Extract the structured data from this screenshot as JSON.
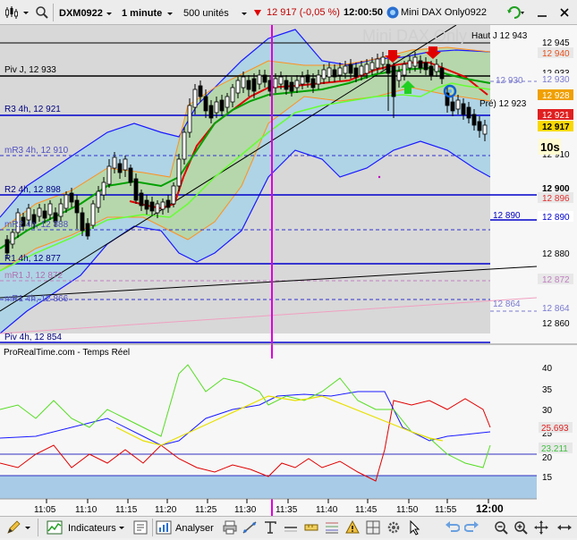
{
  "toolbar": {
    "instrument": "DXM0922",
    "timeframe": "1 minute",
    "units": "500 unités",
    "price_change": "12 917  (-0,05 %)",
    "clock": "12:00:50",
    "product": "Mini DAX Only0922"
  },
  "chart": {
    "watermark": "Mini DAX Only",
    "provider": "ProRealTime.com - Temps Réel",
    "countdown": "10s",
    "price_ticks": [
      "12 945",
      "12 933",
      "12 910",
      "12 900",
      "12 880",
      "12 860"
    ],
    "price_boxes": [
      {
        "text": "12 940",
        "color": "#e8501a",
        "bg": "#e8e8e8"
      },
      {
        "text": "12 930",
        "color": "#7a7ad0",
        "bg": "#f7f7f7"
      },
      {
        "text": "12 928",
        "color": "#ffffff",
        "bg": "#f0a000"
      },
      {
        "text": "12 921",
        "color": "#ffffff",
        "bg": "#e02020"
      },
      {
        "text": "12 917",
        "color": "#000000",
        "bg": "#f8d800"
      },
      {
        "text": "12 896",
        "color": "#e03030",
        "bg": "#e8e8e8"
      },
      {
        "text": "12 890",
        "color": "#0000d0",
        "bg": "#ffffff"
      },
      {
        "text": "12 872",
        "color": "#c080c0",
        "bg": "#e8e8e8"
      },
      {
        "text": "12 864",
        "color": "#7a7ad0",
        "bg": "#f7f7f7"
      }
    ],
    "levels": {
      "haut_j": "Haut J 12 943",
      "piv_j": "Piv J, 12 933",
      "r3_4h": "R3 4h, 12 921",
      "pre": "Pré) 12 923",
      "mr3_4h": "mR3 4h, 12 910",
      "r2_4h": "R2 4h, 12 898",
      "mr2_4h": "mR2 4h, 12 888",
      "r1_4h": "R1 4h, 12 877",
      "pr1_j": "mR1 J, 12 872",
      "mr1_4h": "mR1 4h, 12 866",
      "piv_4h": "Piv 4h, 12 854",
      "right_890": "12 890",
      "right_864": "12 864",
      "right_930": "12 930"
    },
    "osc_ticks": [
      "40",
      "35",
      "30",
      "25",
      "20",
      "15"
    ],
    "osc_boxes": [
      {
        "text": "25.693",
        "color": "#e02020"
      },
      {
        "text": "23.211",
        "color": "#60d060"
      }
    ],
    "time_ticks": [
      "11:05",
      "11:10",
      "11:15",
      "11:20",
      "11:25",
      "11:30",
      "11:35",
      "11:40",
      "11:45",
      "11:50",
      "11:55",
      "12:00"
    ]
  },
  "bottombar": {
    "indicators": "Indicateurs",
    "analyser": "Analyser"
  },
  "colors": {
    "bollinger": "#1a1aff",
    "red_ma": "#e00000",
    "green_ma": "#00a000",
    "lime_ma": "#66ff33",
    "orange_band": "#ff9020",
    "vertical_marker": "#e000e0",
    "level_blue": "#0000cc"
  }
}
